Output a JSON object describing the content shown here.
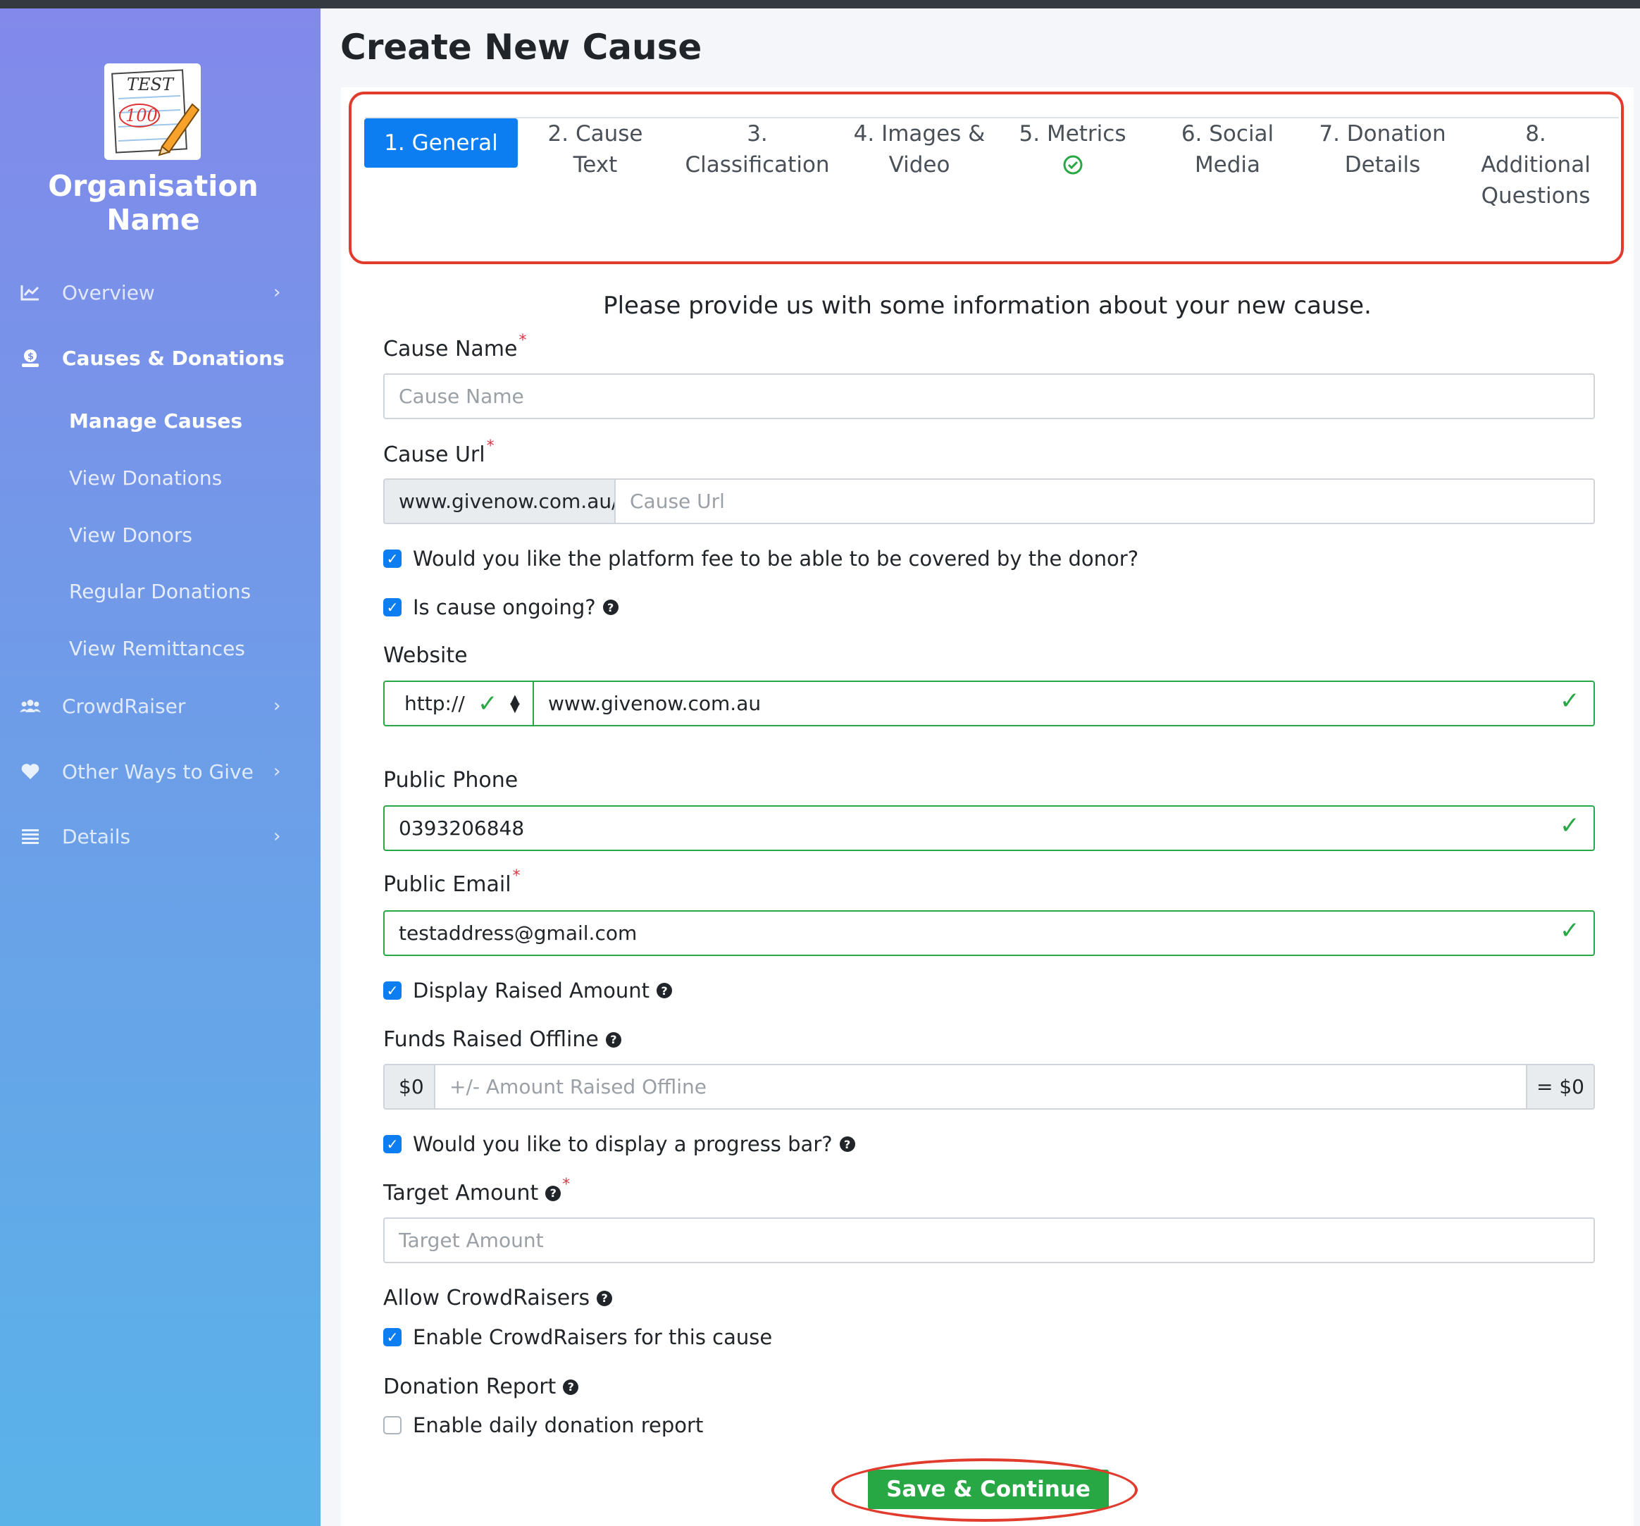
{
  "app": {
    "page_title": "Create New Cause",
    "org_name": "Organisation Name",
    "logo_text": "TEST",
    "logo_score": "100"
  },
  "sidebar": {
    "items": [
      {
        "label": "Overview",
        "icon": "chart-line-icon"
      },
      {
        "label": "Causes & Donations",
        "icon": "donate-icon"
      },
      {
        "label": "CrowdRaiser",
        "icon": "users-icon"
      },
      {
        "label": "Other Ways to Give",
        "icon": "heart-icon"
      },
      {
        "label": "Details",
        "icon": "list-icon"
      }
    ],
    "sub_items": [
      {
        "label": "Manage Causes"
      },
      {
        "label": "View Donations"
      },
      {
        "label": "View Donors"
      },
      {
        "label": "Regular Donations"
      },
      {
        "label": "View Remittances"
      }
    ]
  },
  "tabs": [
    {
      "line1": "1. General",
      "line2": "",
      "line3": ""
    },
    {
      "line1": "2. Cause",
      "line2": "Text",
      "line3": ""
    },
    {
      "line1": "3.",
      "line2": "Classification",
      "line3": ""
    },
    {
      "line1": "4. Images &",
      "line2": "Video",
      "line3": ""
    },
    {
      "line1": "5. Metrics",
      "line2": "",
      "line3": ""
    },
    {
      "line1": "6. Social",
      "line2": "Media",
      "line3": ""
    },
    {
      "line1": "7. Donation",
      "line2": "Details",
      "line3": ""
    },
    {
      "line1": "8.",
      "line2": "Additional",
      "line3": "Questions"
    }
  ],
  "form": {
    "intro": "Please provide us with some information about your new cause.",
    "cause_name": {
      "label": "Cause Name",
      "placeholder": "Cause Name",
      "value": ""
    },
    "cause_url": {
      "label": "Cause Url",
      "prefix": "www.givenow.com.au/",
      "placeholder": "Cause Url",
      "value": ""
    },
    "platform_fee": {
      "label": "Would you like the platform fee to be able to be covered by the donor?",
      "checked": true
    },
    "ongoing": {
      "label": "Is cause ongoing?",
      "checked": true
    },
    "website": {
      "label": "Website",
      "protocol": "http://",
      "value": "www.givenow.com.au"
    },
    "public_phone": {
      "label": "Public Phone",
      "value": "0393206848"
    },
    "public_email": {
      "label": "Public Email",
      "value": "testaddress@gmail.com"
    },
    "display_raised": {
      "label": "Display Raised Amount",
      "checked": true
    },
    "funds_offline": {
      "label": "Funds Raised Offline",
      "prefix": "$0",
      "placeholder": "+/- Amount Raised Offline",
      "suffix": "= $0"
    },
    "progress_bar": {
      "label": "Would you like to display a progress bar?",
      "checked": true
    },
    "target_amount": {
      "label": "Target Amount",
      "placeholder": "Target Amount"
    },
    "allow_crowdraisers": {
      "label": "Allow CrowdRaisers",
      "checkbox_label": "Enable CrowdRaisers for this cause",
      "checked": true
    },
    "donation_report": {
      "label": "Donation Report",
      "checkbox_label": "Enable daily donation report",
      "checked": false
    },
    "save_label": "Save & Continue"
  },
  "colors": {
    "accent": "#0d7ef2",
    "success": "#28a745",
    "highlight": "#e03b2d"
  }
}
